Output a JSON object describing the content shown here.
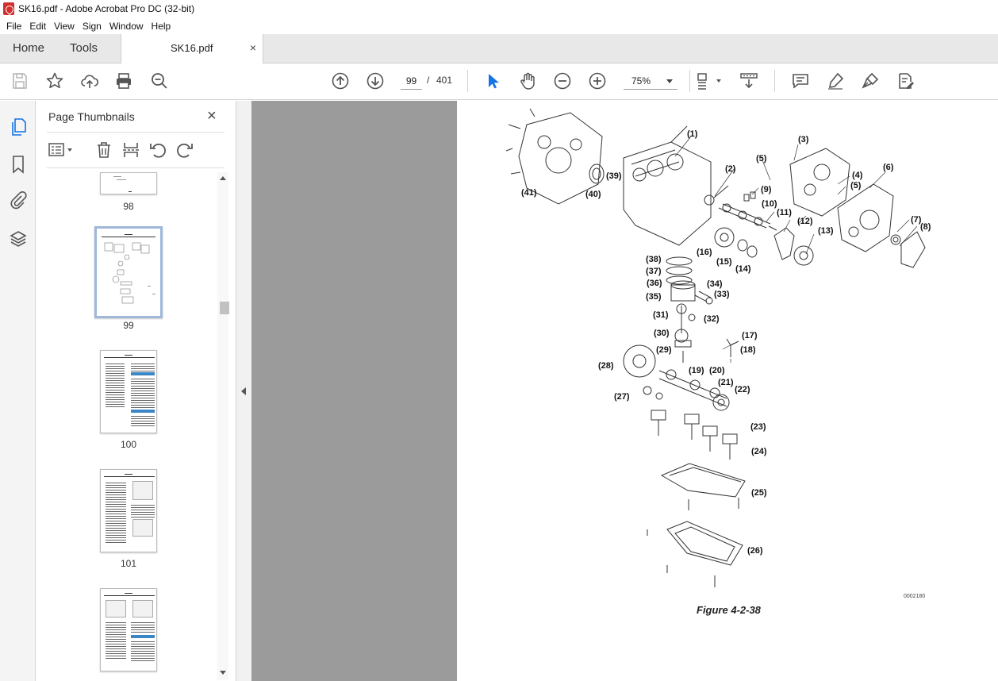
{
  "window": {
    "title": "SK16.pdf - Adobe Acrobat Pro DC (32-bit)"
  },
  "menubar": {
    "items": [
      "File",
      "Edit",
      "View",
      "Sign",
      "Window",
      "Help"
    ]
  },
  "tabs": {
    "home": "Home",
    "tools": "Tools",
    "document": "SK16.pdf",
    "close": "×"
  },
  "toolbar": {
    "page_current": "99",
    "page_separator": "/",
    "page_total": "401",
    "zoom": "75%"
  },
  "thumbnails_panel": {
    "title": "Page Thumbnails",
    "close": "×",
    "pages": [
      "98",
      "99",
      "100",
      "101"
    ]
  },
  "document": {
    "figure_caption": "Figure 4-2-38",
    "figure_code": "0002180",
    "callouts": [
      "(1)",
      "(2)",
      "(3)",
      "(4)",
      "(5)",
      "(5)",
      "(6)",
      "(7)",
      "(8)",
      "(9)",
      "(10)",
      "(11)",
      "(12)",
      "(13)",
      "(14)",
      "(15)",
      "(16)",
      "(17)",
      "(18)",
      "(19)",
      "(20)",
      "(21)",
      "(22)",
      "(23)",
      "(24)",
      "(25)",
      "(26)",
      "(27)",
      "(28)",
      "(29)",
      "(30)",
      "(31)",
      "(32)",
      "(33)",
      "(34)",
      "(35)",
      "(36)",
      "(37)",
      "(38)",
      "(39)",
      "(40)",
      "(41)"
    ]
  },
  "colors": {
    "accent_blue": "#1473e6",
    "pdf_red": "#d32f2f",
    "viewer_gray": "#9b9b9b",
    "selected_thumb_border": "#9fb7d8"
  }
}
